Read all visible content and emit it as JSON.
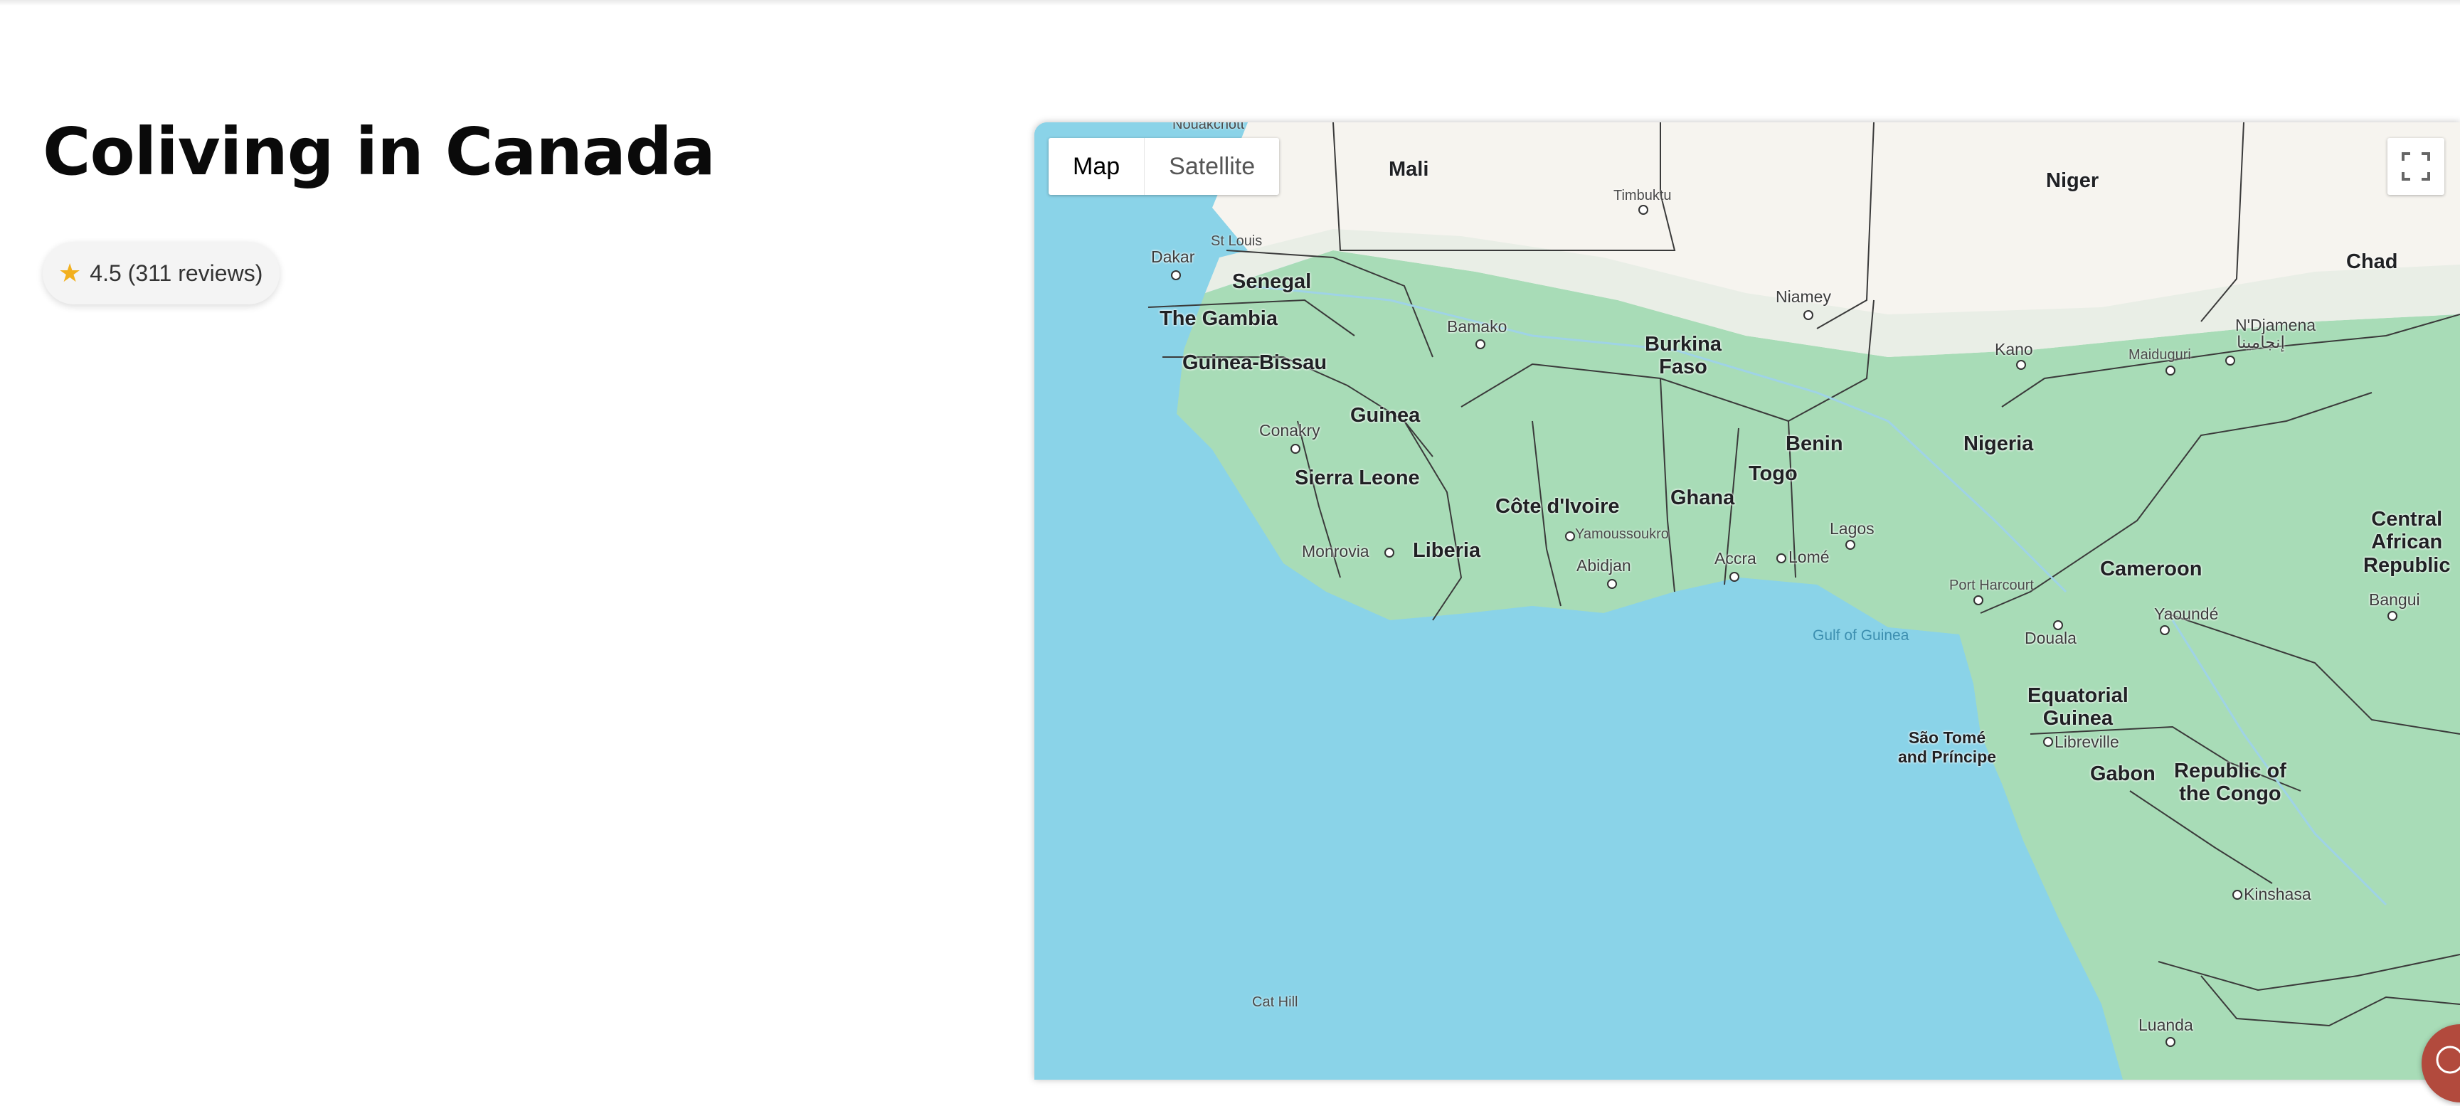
{
  "page": {
    "title": "Coliving in Canada",
    "rating": {
      "star_icon": "star-icon",
      "text": "4.5 (311 reviews)",
      "star_color": "#f2b01e"
    }
  },
  "map": {
    "map_type_control": {
      "map_label": "Map",
      "satellite_label": "Satellite",
      "selected": "Map"
    },
    "fullscreen_icon": "fullscreen-icon",
    "water_color": "#8ad3e8",
    "land_color": "#a8dcb7",
    "countries": {
      "mali": "Mali",
      "niger": "Niger",
      "chad": "Chad",
      "senegal": "Senegal",
      "the_gambia": "The Gambia",
      "guinea_bissau": "Guinea-Bissau",
      "guinea": "Guinea",
      "sierra_leone": "Sierra Leone",
      "liberia": "Liberia",
      "cote_divoire": "Côte d'Ivoire",
      "ghana": "Ghana",
      "togo": "Togo",
      "benin": "Benin",
      "burkina_faso": "Burkina\nFaso",
      "nigeria": "Nigeria",
      "cameroon": "Cameroon",
      "car": "Central\nAfrican\nRepublic",
      "equatorial_guinea": "Equatorial\nGuinea",
      "sao_tome": "São Tomé\nand Príncipe",
      "gabon": "Gabon",
      "republic_congo": "Republic of\nthe Congo"
    },
    "cities": {
      "nouakchott": "Nouakchott",
      "timbuktu": "Timbuktu",
      "st_louis": "St Louis",
      "dakar": "Dakar",
      "bamako": "Bamako",
      "niamey": "Niamey",
      "ndjamena": "N'Djamena",
      "ndjamena_ar": "إنجامينا",
      "kano": "Kano",
      "maiduguri": "Maiduguri",
      "conakry": "Conakry",
      "monrovia": "Monrovia",
      "yamoussoukro": "Yamoussoukro",
      "abidjan": "Abidjan",
      "accra": "Accra",
      "lome": "Lomé",
      "lagos": "Lagos",
      "port_harcourt": "Port Harcourt",
      "yaounde": "Yaoundé",
      "douala": "Douala",
      "bangui": "Bangui",
      "libreville": "Libreville",
      "kinshasa": "Kinshasa",
      "luanda": "Luanda",
      "cat_hill": "Cat Hill"
    },
    "water_bodies": {
      "gulf_of_guinea": "Gulf of Guinea"
    }
  },
  "chat_button": {
    "icon": "chat-icon",
    "color": "#b24a3d"
  }
}
